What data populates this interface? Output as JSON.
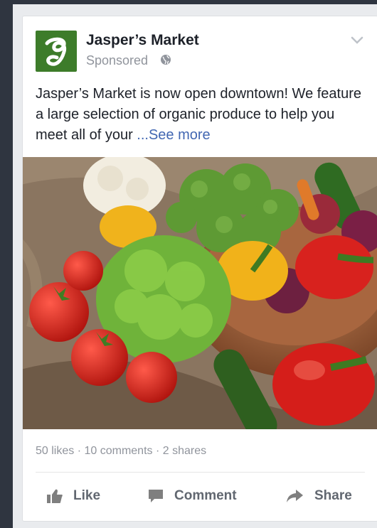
{
  "post": {
    "page_name": "Jasper’s Market",
    "sponsored_label": "Sponsored",
    "text": "Jasper’s Market is now open downtown! We feature a large selection of organic produce to help you meet all of your",
    "see_more": "...See more",
    "logo_icon": "jaspers-market-logo",
    "audience_icon": "globe-icon",
    "options_icon": "chevron-down-icon"
  },
  "photo": {
    "subject": "organic vegetables"
  },
  "engagement": {
    "stats": "50 likes · 10 comments · 2 shares"
  },
  "actions": {
    "like": "Like",
    "comment": "Comment",
    "share": "Share"
  },
  "colors": {
    "link": "#4267b2",
    "logo_bg": "#3d7c2a",
    "meta_text": "#90949c",
    "action_text": "#616770"
  }
}
